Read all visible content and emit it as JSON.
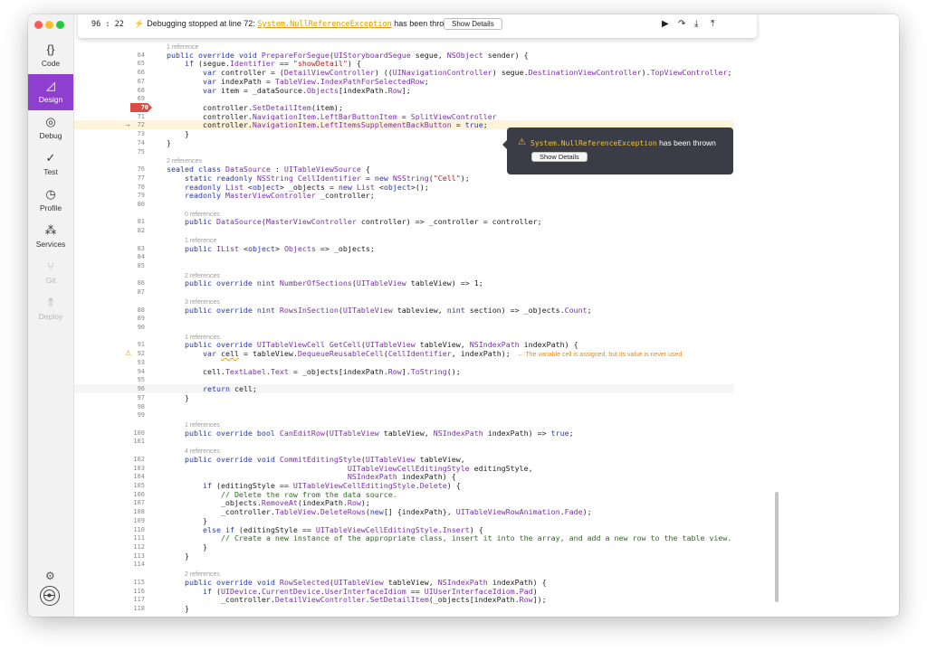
{
  "nav": [
    {
      "label": "Code",
      "icon": "{}"
    },
    {
      "label": "Design",
      "icon": "◿"
    },
    {
      "label": "Debug",
      "icon": "◎"
    },
    {
      "label": "Test",
      "icon": "✓"
    },
    {
      "label": "Profile",
      "icon": "◷"
    },
    {
      "label": "Services",
      "icon": "⁂"
    },
    {
      "label": "Git",
      "icon": "⑂"
    },
    {
      "label": "Deploy",
      "icon": "⇑"
    }
  ],
  "toolbar": {
    "line_col": "96 : 22",
    "message_prefix": "Debugging stopped at line 72:",
    "exception": "System.NullReferenceException",
    "message_suffix": "has been thrown",
    "show_details": "Show Details"
  },
  "popup": {
    "exception": "System.NullReferenceException",
    "suffix": "has been thrown",
    "show_details": "Show Details"
  },
  "breakpoint_line": "70",
  "current_line": "72",
  "code": [
    {
      "n": "",
      "t": "1 reference",
      "ref": true,
      "i": 0
    },
    {
      "n": "64",
      "h": "<span class=\"kw\">public override void</span> <span class=\"tp\">PrepareForSegue</span>(<span class=\"tp\">UIStoryboardSegue</span> segue, <span class=\"tp\">NSObject</span> sender) {"
    },
    {
      "n": "65",
      "h": "    <span class=\"kw\">if</span> (segue.<span class=\"tp\">Identifier</span> == <span class=\"str\">\"showDetail\"</span>) {"
    },
    {
      "n": "66",
      "h": "        <span class=\"kw\">var</span> controller = (<span class=\"tp\">DetailViewController</span>) ((<span class=\"tp\">UINavigationController</span>) segue.<span class=\"tp\">DestinationViewController</span>).<span class=\"tp\">TopViewController</span>;"
    },
    {
      "n": "67",
      "h": "        <span class=\"kw\">var</span> indexPath = <span class=\"tp\">TableView</span>.<span class=\"tp\">IndexPathForSelectedRow</span>;"
    },
    {
      "n": "68",
      "h": "        <span class=\"kw\">var</span> item = _dataSource.<span class=\"tp\">Objects</span>[indexPath.<span class=\"tp\">Row</span>];"
    },
    {
      "n": "69",
      "h": ""
    },
    {
      "n": "70",
      "h": "        controller.<span class=\"tp\">SetDetailItem</span>(item);",
      "bp": true
    },
    {
      "n": "71",
      "h": "        controller.<span class=\"tp\">NavigationItem</span>.<span class=\"tp\">LeftBarButtonItem</span> = <span class=\"tp\">SplitViewController</span>"
    },
    {
      "n": "72",
      "h": "        controller.<span class=\"tp\">NavigationItem</span>.<span class=\"tp\">LeftItemsSupplementBackButton</span> = <span class=\"kw\">true</span>;",
      "cur": true
    },
    {
      "n": "73",
      "h": "    }"
    },
    {
      "n": "74",
      "h": "}"
    },
    {
      "n": "75",
      "h": ""
    },
    {
      "n": "",
      "t": "2 references",
      "ref": true,
      "i": 0
    },
    {
      "n": "76",
      "h": "<span class=\"kw\">sealed class</span> <span class=\"tp\">DataSource</span> : <span class=\"tp\">UITableViewSource</span> {"
    },
    {
      "n": "77",
      "h": "    <span class=\"kw\">static readonly</span> <span class=\"tp\">NSString</span> <span class=\"tp\">CellIdentifier</span> = <span class=\"kw\">new</span> <span class=\"tp\">NSString</span>(<span class=\"str\">\"Cell\"</span>);"
    },
    {
      "n": "78",
      "h": "    <span class=\"kw\">readonly</span> <span class=\"tp\">List</span> &lt;<span class=\"kw\">object</span>&gt; _objects = <span class=\"kw\">new</span> <span class=\"tp\">List</span> &lt;<span class=\"kw\">object</span>&gt;();"
    },
    {
      "n": "79",
      "h": "    <span class=\"kw\">readonly</span> <span class=\"tp\">MasterViewController</span> _controller;"
    },
    {
      "n": "80",
      "h": ""
    },
    {
      "n": "",
      "t": "0 references",
      "ref": true,
      "i": 4
    },
    {
      "n": "81",
      "h": "    <span class=\"kw\">public</span> <span class=\"tp\">DataSource</span>(<span class=\"tp\">MasterViewController</span> controller) =&gt; _controller = controller;"
    },
    {
      "n": "82",
      "h": ""
    },
    {
      "n": "",
      "t": "1 reference",
      "ref": true,
      "i": 4
    },
    {
      "n": "83",
      "h": "    <span class=\"kw\">public</span> <span class=\"tp\">IList</span> &lt;<span class=\"kw\">object</span>&gt; <span class=\"tp\">Objects</span> =&gt; _objects;"
    },
    {
      "n": "84",
      "h": ""
    },
    {
      "n": "85",
      "h": ""
    },
    {
      "n": "",
      "t": "2 references",
      "ref": true,
      "i": 4
    },
    {
      "n": "86",
      "h": "    <span class=\"kw\">public override nint</span> <span class=\"tp\">NumberOfSections</span>(<span class=\"tp\">UITableView</span> tableView) =&gt; 1;"
    },
    {
      "n": "87",
      "h": ""
    },
    {
      "n": "",
      "t": "3 references",
      "ref": true,
      "i": 4
    },
    {
      "n": "88",
      "h": "    <span class=\"kw\">public override nint</span> <span class=\"tp\">RowsInSection</span>(<span class=\"tp\">UITableView</span> tableview, <span class=\"kw\">nint</span> section) =&gt; _objects.<span class=\"tp\">Count</span>;"
    },
    {
      "n": "89",
      "h": ""
    },
    {
      "n": "90",
      "h": ""
    },
    {
      "n": "",
      "t": "1 references",
      "ref": true,
      "i": 4
    },
    {
      "n": "91",
      "h": "    <span class=\"kw\">public override</span> <span class=\"tp\">UITableViewCell</span> <span class=\"tp\">GetCell</span>(<span class=\"tp\">UITableView</span> tableView, <span class=\"tp\">NSIndexPath</span> indexPath) {"
    },
    {
      "n": "92",
      "h": "        <span class=\"kw\">var</span> <span style=\"text-decoration:underline wavy #e8a21c\">cell</span> = tableView.<span class=\"tp\">DequeueReusableCell</span>(<span class=\"tp\">CellIdentifier</span>, indexPath);",
      "warn": true,
      "hint": "← The variable cell is assigned, but its value is never used"
    },
    {
      "n": "93",
      "h": ""
    },
    {
      "n": "94",
      "h": "        cell.<span class=\"tp\">TextLabel</span>.<span class=\"tp\">Text</span> = _objects[indexPath.<span class=\"tp\">Row</span>].<span class=\"tp\">ToString</span>();"
    },
    {
      "n": "95",
      "h": ""
    },
    {
      "n": "96",
      "h": "        <span class=\"kw\">return</span> cell;",
      "light": true
    },
    {
      "n": "97",
      "h": "    }"
    },
    {
      "n": "98",
      "h": ""
    },
    {
      "n": "99",
      "h": ""
    },
    {
      "n": "",
      "t": "1 references",
      "ref": true,
      "i": 4
    },
    {
      "n": "100",
      "h": "    <span class=\"kw\">public override bool</span> <span class=\"tp\">CanEditRow</span>(<span class=\"tp\">UITableView</span> tableView, <span class=\"tp\">NSIndexPath</span> indexPath) =&gt; <span class=\"kw\">true</span>;"
    },
    {
      "n": "101",
      "h": ""
    },
    {
      "n": "",
      "t": "4 references",
      "ref": true,
      "i": 4
    },
    {
      "n": "102",
      "h": "    <span class=\"kw\">public override void</span> <span class=\"tp\">CommitEditingStyle</span>(<span class=\"tp\">UITableView</span> tableView,"
    },
    {
      "n": "103",
      "h": "                                        <span class=\"tp\">UITableViewCellEditingStyle</span> editingStyle,"
    },
    {
      "n": "104",
      "h": "                                        <span class=\"tp\">NSIndexPath</span> indexPath) {"
    },
    {
      "n": "105",
      "h": "        <span class=\"kw\">if</span> (editingStyle == <span class=\"tp\">UITableViewCellEditingStyle</span>.<span class=\"tp\">Delete</span>) {"
    },
    {
      "n": "106",
      "h": "            <span class=\"cm\">// Delete the row from the data source.</span>"
    },
    {
      "n": "107",
      "h": "            _objects.<span class=\"tp\">RemoveAt</span>(indexPath.<span class=\"tp\">Row</span>);"
    },
    {
      "n": "108",
      "h": "            _controller.<span class=\"tp\">TableView</span>.<span class=\"tp\">DeleteRows</span>(<span class=\"kw\">new</span>[] {indexPath}, <span class=\"tp\">UITableViewRowAnimation</span>.<span class=\"tp\">Fade</span>);"
    },
    {
      "n": "109",
      "h": "        }"
    },
    {
      "n": "110",
      "h": "        <span class=\"kw\">else if</span> (editingStyle == <span class=\"tp\">UITableViewCellEditingStyle</span>.<span class=\"tp\">Insert</span>) {"
    },
    {
      "n": "111",
      "h": "            <span class=\"cm\">// Create a new instance of the appropriate class, insert it into the array, and add a new row to the table view.</span>"
    },
    {
      "n": "112",
      "h": "        }"
    },
    {
      "n": "113",
      "h": "    }"
    },
    {
      "n": "114",
      "h": ""
    },
    {
      "n": "",
      "t": "2 references",
      "ref": true,
      "i": 4
    },
    {
      "n": "115",
      "h": "    <span class=\"kw\">public override void</span> <span class=\"tp\">RowSelected</span>(<span class=\"tp\">UITableView</span> tableView, <span class=\"tp\">NSIndexPath</span> indexPath) {"
    },
    {
      "n": "116",
      "h": "        <span class=\"kw\">if</span> (<span class=\"tp\">UIDevice</span>.<span class=\"tp\">CurrentDevice</span>.<span class=\"tp\">UserInterfaceIdiom</span> == <span class=\"tp\">UIUserInterfaceIdiom</span>.<span class=\"tp\">Pad</span>)"
    },
    {
      "n": "117",
      "h": "            _controller.<span class=\"tp\">DetailViewController</span>.<span class=\"tp\">SetDetailItem</span>(_objects[indexPath.<span class=\"tp\">Row</span>]);"
    },
    {
      "n": "118",
      "h": "    }"
    }
  ]
}
